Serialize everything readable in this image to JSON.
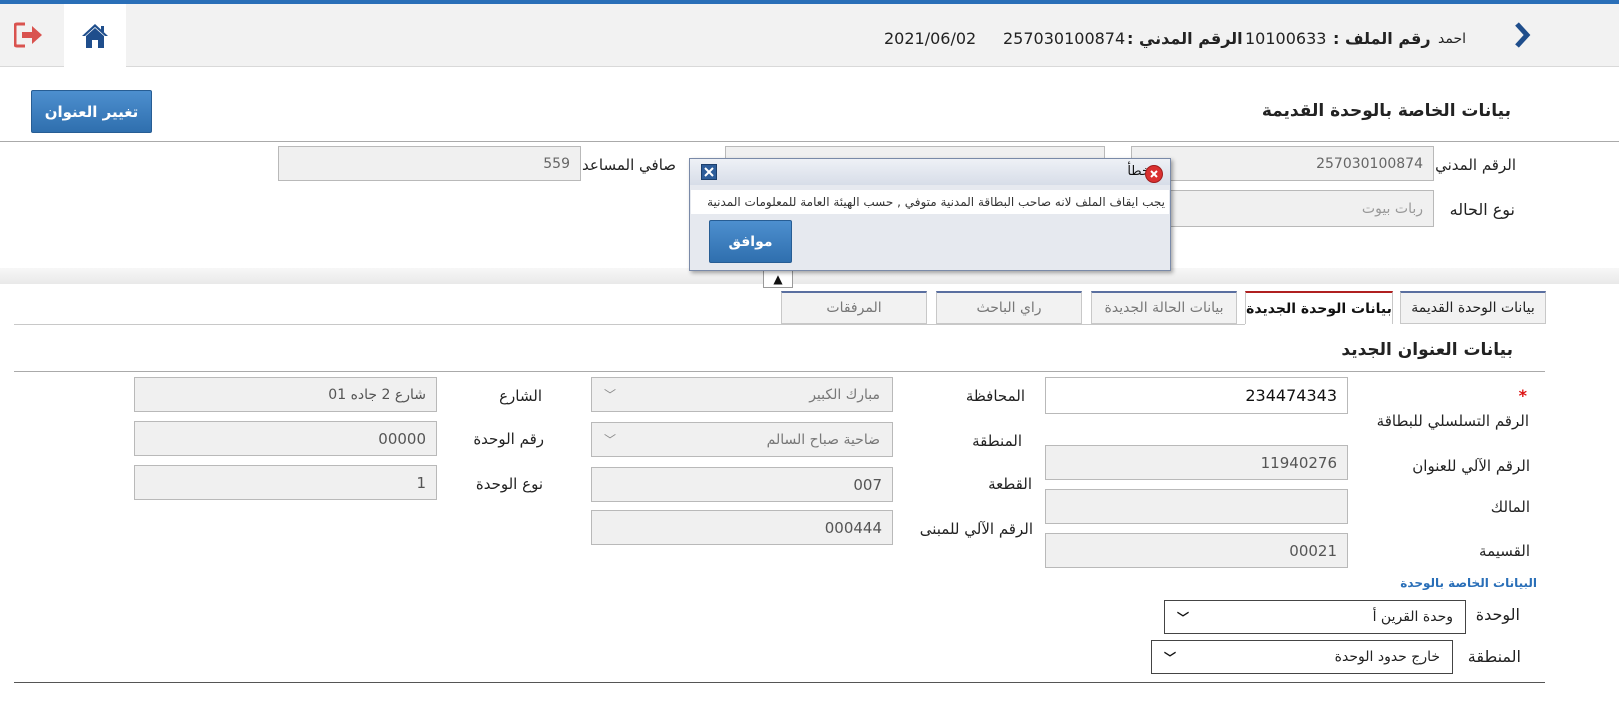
{
  "header": {
    "user_name": "احمد",
    "file_label": "رقم الملف :",
    "file_number": "10100633",
    "civil_label": "الرقم المدني :",
    "civil_number": "257030100874",
    "date": "2021/06/02"
  },
  "old_unit": {
    "title": "بيانات الخاصة بالوحدة القديمة",
    "change_address_button": "تغيير العنوان",
    "civil_id_label": "الرقم المدني",
    "civil_id_value": "257030100874",
    "case_type_label": "نوع الحاله",
    "case_type_value": "ربات بيوت",
    "net_assistance_label": "صافي المساعدة",
    "net_assistance_value": "559"
  },
  "dialog": {
    "title": "خطأ",
    "message": "يجب ايقاف الملف لانه صاحب البطاقة المدنية متوفي , حسب الهيئة العامة للمعلومات المدنية",
    "ok_button": "موافق"
  },
  "collapse_toggle": "▲",
  "tabs": [
    {
      "label": "بيانات الوحدة القديمة"
    },
    {
      "label": "بيانات الوحدة الجديدة"
    },
    {
      "label": "بيانات الحالة الجديدة"
    },
    {
      "label": "راي الباحث"
    },
    {
      "label": "المرفقات"
    }
  ],
  "new_address": {
    "title": "بيانات العنوان الجديد",
    "required_mark": "*",
    "card_serial_label": "الرقم التسلسلي للبطاقة",
    "card_serial_value": "234474343",
    "auto_address_label": "الرقم الآلي للعنوان",
    "auto_address_value": "11940276",
    "owner_label": "المالك",
    "owner_value": "",
    "plot_label": "القسيمة",
    "plot_value": "00021",
    "governorate_label": "المحافظة",
    "governorate_value": "مبارك الكبير",
    "area_label": "المنطقة",
    "area_value": "ضاحية صباح السالم",
    "block_label": "القطعة",
    "block_value": "007",
    "building_auto_label": "الرقم الآلي للمبنى",
    "building_auto_value": "000444",
    "street_label": "الشارع",
    "street_value": "شارع 2 جاده 01",
    "unit_number_label": "رقم الوحدة",
    "unit_number_value": "00000",
    "unit_type_label": "نوع الوحدة",
    "unit_type_value": "1"
  },
  "unit_section": {
    "title": "البيانات الخاصة بالوحدة",
    "unit_label": "الوحدة",
    "unit_value": "وحدة القرين أ",
    "region_label": "المنطقة",
    "region_value": "خارج حدود الوحدة"
  },
  "colors": {
    "accent_blue": "#2a6fb8",
    "logout_red": "#d9534f",
    "active_tab_border": "#b02020",
    "section_link_blue": "#2a6fb8"
  }
}
